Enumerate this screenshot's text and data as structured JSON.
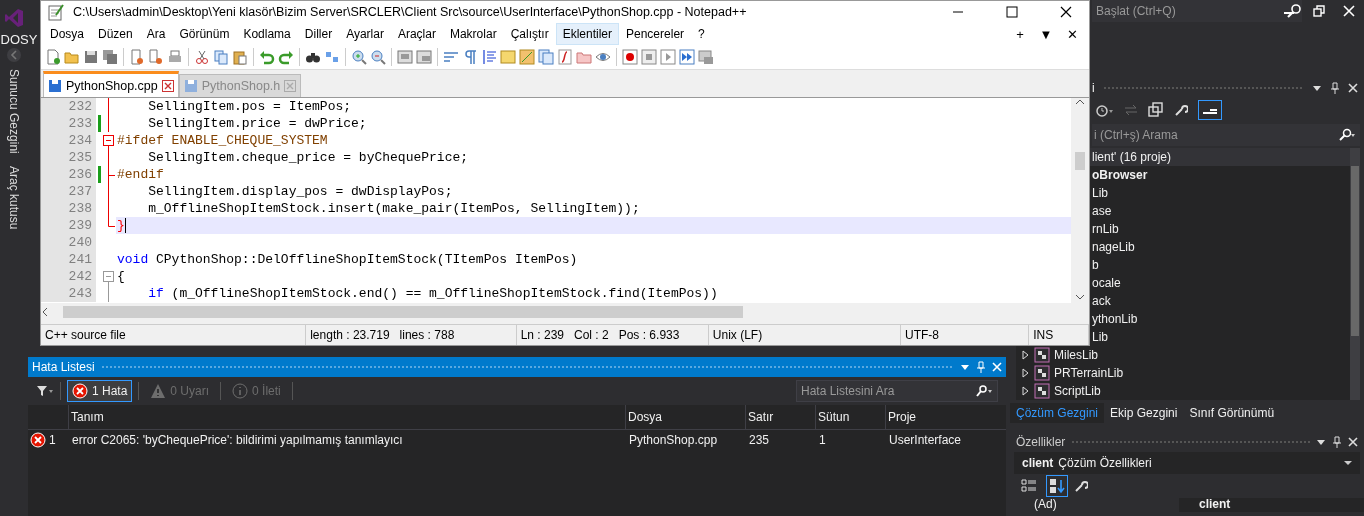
{
  "vs": {
    "menu": "DOSY",
    "quick_launch": {
      "placeholder": "Başlat (Ctrl+Q)"
    },
    "side_tabs": [
      {
        "label": "Sunucu Gezgini"
      },
      {
        "label": "Araç kutusu"
      }
    ]
  },
  "notepad": {
    "title": "C:\\Users\\admin\\Desktop\\Yeni klasör\\Bizim Server\\SRCLER\\Client Src\\source\\UserInterface\\PythonShop.cpp - Notepad++",
    "menu": [
      {
        "label": "Dosya",
        "selected": false
      },
      {
        "label": "Düzen",
        "selected": false
      },
      {
        "label": "Ara",
        "selected": false
      },
      {
        "label": "Görünüm",
        "selected": false
      },
      {
        "label": "Kodlama",
        "selected": false
      },
      {
        "label": "Diller",
        "selected": false
      },
      {
        "label": "Ayarlar",
        "selected": false
      },
      {
        "label": "Araçlar",
        "selected": false
      },
      {
        "label": "Makrolar",
        "selected": false
      },
      {
        "label": "Çalıştır",
        "selected": false
      },
      {
        "label": "Eklentiler",
        "selected": true
      },
      {
        "label": "Pencereler",
        "selected": false
      },
      {
        "label": "?",
        "selected": false
      }
    ],
    "menu_right": [
      "+",
      "▼",
      "✕"
    ],
    "tabs": [
      {
        "label": "PythonShop.cpp",
        "selected": true
      },
      {
        "label": "PythonShop.h",
        "selected": false
      }
    ],
    "lines": [
      {
        "number": "232",
        "current": false,
        "changed": false,
        "kind": "fold_body",
        "fold_active": true,
        "indented": true,
        "tokens": [
          {
            "text": "SellingItem.pos = ItemPos;",
            "kind": "default"
          }
        ]
      },
      {
        "number": "233",
        "current": false,
        "changed": true,
        "kind": "fold_body",
        "fold_active": true,
        "indented": true,
        "tokens": [
          {
            "text": "SellingItem.price = dwPrice;",
            "kind": "default"
          }
        ]
      },
      {
        "number": "234",
        "current": false,
        "changed": false,
        "kind": "fold_start",
        "fold_active": true,
        "indented": false,
        "tokens": [
          {
            "text": "#ifdef ENABLE_CHEQUE_SYSTEM",
            "kind": "preproc"
          }
        ]
      },
      {
        "number": "235",
        "current": false,
        "changed": false,
        "kind": "fold_body",
        "fold_active": true,
        "indented": true,
        "tokens": [
          {
            "text": "SellingItem.cheque_price = byChequePrice;",
            "kind": "default"
          }
        ]
      },
      {
        "number": "236",
        "current": false,
        "changed": true,
        "kind": "fold_branch",
        "fold_active": true,
        "indented": false,
        "tokens": [
          {
            "text": "#endif",
            "kind": "preproc"
          }
        ]
      },
      {
        "number": "237",
        "current": false,
        "changed": false,
        "kind": "fold_body",
        "fold_active": true,
        "indented": true,
        "tokens": [
          {
            "text": "SellingItem.display_pos = dwDisplayPos;",
            "kind": "default"
          }
        ]
      },
      {
        "number": "238",
        "current": false,
        "changed": false,
        "kind": "fold_body",
        "fold_active": true,
        "indented": true,
        "tokens": [
          {
            "text": "m_OfflineShopItemStock.insert(make_pair(ItemPos, SellingItem));",
            "kind": "default"
          }
        ]
      },
      {
        "number": "239",
        "current": true,
        "changed": false,
        "kind": "fold_end",
        "fold_active": true,
        "indented": false,
        "tokens": [
          {
            "text": "}",
            "kind": "brace"
          }
        ]
      },
      {
        "number": "240",
        "current": false,
        "changed": false,
        "kind": "plain"
      },
      {
        "number": "241",
        "current": false,
        "changed": false,
        "kind": "plain",
        "indented": false,
        "tokens": [
          {
            "text": "void",
            "kind": "keyword"
          },
          {
            "text": " CPythonShop::DelOfflineShopItemStock(TItemPos ItemPos)",
            "kind": "default"
          }
        ]
      },
      {
        "number": "242",
        "current": false,
        "changed": false,
        "kind": "fold_start",
        "fold_active": false,
        "indented": false,
        "tokens": [
          {
            "text": "{",
            "kind": "default"
          }
        ]
      },
      {
        "number": "243",
        "current": false,
        "changed": false,
        "kind": "fold_body",
        "fold_active": false,
        "indented": true,
        "tokens": [
          {
            "text": "if",
            "kind": "keyword"
          },
          {
            "text": " (m_OfflineShopItemStock.end() == m_OfflineShopItemStock.find(ItemPos))",
            "kind": "default"
          }
        ]
      }
    ],
    "status": [
      {
        "texts": [
          "C++ source file"
        ]
      },
      {
        "texts": [
          "length : 23.719",
          "lines : 788"
        ]
      },
      {
        "texts": [
          "Ln : 239",
          "Col : 2",
          "Pos : 6.933"
        ]
      },
      {
        "texts": [
          "Unix (LF)"
        ]
      },
      {
        "texts": [
          "UTF-8"
        ]
      },
      {
        "texts": [
          "INS"
        ]
      }
    ]
  },
  "error_list": {
    "title": "Hata Listesi",
    "filters": [
      {
        "label": "1 Hata",
        "kind": "error",
        "selected": true,
        "disabled": false
      },
      {
        "label": "0 Uyarı",
        "kind": "warning",
        "selected": false,
        "disabled": true
      },
      {
        "label": "0 İleti",
        "kind": "info",
        "selected": false,
        "disabled": true
      }
    ],
    "search": {
      "placeholder": "Hata Listesini Ara"
    },
    "columns": [
      "Tanım",
      "Dosya",
      "Satır",
      "Sütun",
      "Proje"
    ],
    "rows": [
      {
        "index": "1",
        "cells": [
          "error C2065: 'byChequePrice': bildirimi yapılmamış tanımlayıcı",
          "PythonShop.cpp",
          "235",
          "1",
          "UserInterface"
        ]
      }
    ]
  },
  "solution_explorer": {
    "title": "i",
    "search": {
      "placeholder": "i (Ctrl+ş) Arama"
    },
    "root": "lient' (16 proje)",
    "items": [
      {
        "label": "oBrowser",
        "kind": "clipped",
        "startup": true
      },
      {
        "label": "Lib",
        "kind": "clipped",
        "startup": false
      },
      {
        "label": "ase",
        "kind": "clipped",
        "startup": false
      },
      {
        "label": "rnLib",
        "kind": "clipped",
        "startup": false
      },
      {
        "label": "nageLib",
        "kind": "clipped",
        "startup": false
      },
      {
        "label": "b",
        "kind": "clipped",
        "startup": false
      },
      {
        "label": "ocale",
        "kind": "clipped",
        "startup": false
      },
      {
        "label": "ack",
        "kind": "clipped",
        "startup": false
      },
      {
        "label": "ythonLib",
        "kind": "clipped",
        "startup": false
      },
      {
        "label": "Lib",
        "kind": "clipped",
        "startup": false
      },
      {
        "label": "MilesLib",
        "kind": "project",
        "startup": false
      },
      {
        "label": "PRTerrainLib",
        "kind": "project",
        "startup": false
      },
      {
        "label": "ScriptLib",
        "kind": "project",
        "startup": false
      }
    ],
    "tabs": [
      {
        "label": "Çözüm Gezgini",
        "selected": true
      },
      {
        "label": "Ekip Gezgini",
        "selected": false
      },
      {
        "label": "Sınıf Görünümü",
        "selected": false
      }
    ]
  },
  "properties": {
    "title": "Özellikler",
    "object": "client",
    "object_type": "Çözüm Özellikleri",
    "views": [
      {
        "kind": "categorized",
        "selected": false
      },
      {
        "kind": "alphabetical",
        "selected": true
      }
    ],
    "rows": [
      {
        "name": "(Ad)",
        "value": "client"
      }
    ]
  }
}
